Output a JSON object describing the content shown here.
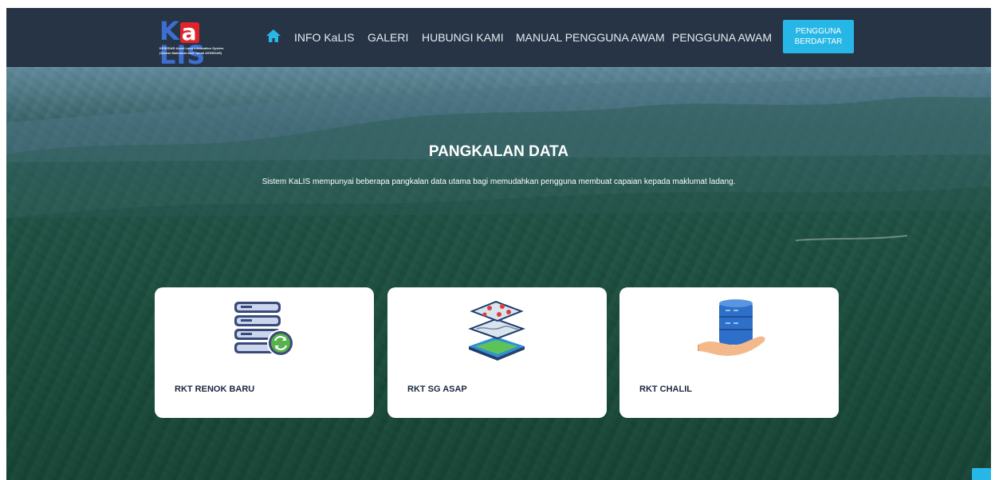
{
  "brand": {
    "logo_text": "KaLIS",
    "logo_sub1": "KESEDAR Asset Land Information System",
    "logo_sub2": "(Sistem Maklumat Aset Tanah KESEDAR)"
  },
  "nav": {
    "home_icon": "home-icon",
    "items": [
      {
        "label": "INFO KaLIS"
      },
      {
        "label": "GALERI"
      },
      {
        "label": "HUBUNGI KAMI"
      },
      {
        "label": "MANUAL PENGGUNA AWAM"
      },
      {
        "label": "PENGGUNA AWAM"
      }
    ],
    "cta_line1": "PENGGUNA",
    "cta_line2": "BERDAFTAR"
  },
  "hero": {
    "title": "PANGKALAN DATA",
    "description": "Sistem KaLIS mempunyai beberapa pangkalan data utama bagi memudahkan pengguna membuat capaian kepada maklumat ladang."
  },
  "cards": [
    {
      "label": "RKT RENOK BARU",
      "icon": "database-sync-icon"
    },
    {
      "label": "RKT SG ASAP",
      "icon": "map-layers-icon"
    },
    {
      "label": "RKT CHALIL",
      "icon": "hand-database-icon"
    }
  ],
  "colors": {
    "nav_bg": "#273445",
    "cta_bg": "#27b7e6",
    "card_bg": "#ffffff",
    "card_text": "#1b2740"
  }
}
